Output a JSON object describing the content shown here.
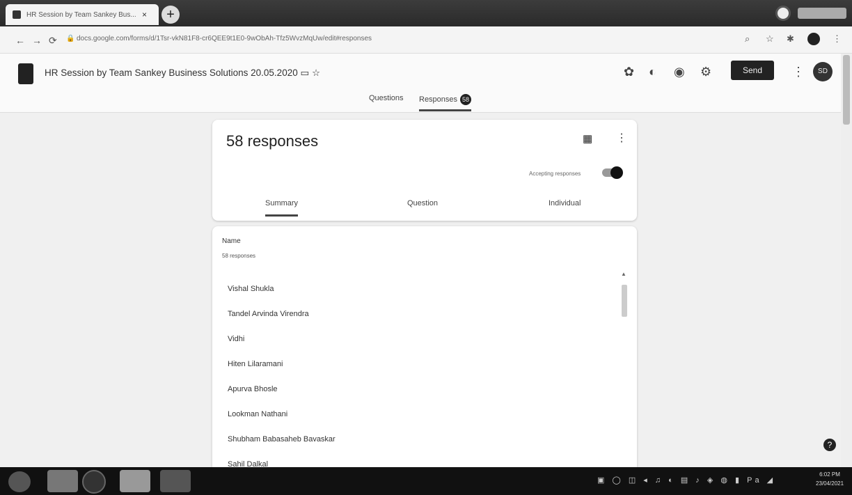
{
  "browser": {
    "tab_title": "HR Session by Team Sankey Bus...",
    "tab_close": "×",
    "new_tab": "+",
    "back": "←",
    "forward": "→",
    "reload": "⟳",
    "lock": "🔒",
    "url": "docs.google.com/forms/d/1Tsr-vkN81F8-cr6QEE9t1E0-9wObAh-Tfz5WvzMqUw/edit#responses"
  },
  "forms_header": {
    "title": "HR Session by Team Sankey Business Solutions 20.05.2020",
    "send_label": "Send",
    "avatar_text": "SD",
    "tabs": [
      {
        "label": "Questions"
      },
      {
        "label": "Responses",
        "badge": "58"
      }
    ]
  },
  "responses_card": {
    "title": "58 responses",
    "accepting_label": "Accepting responses",
    "tabs": [
      {
        "label": "Summary"
      },
      {
        "label": "Question"
      },
      {
        "label": "Individual"
      }
    ]
  },
  "question_card": {
    "title": "Name",
    "count": "58 responses",
    "answers": [
      "Vishal Shukla",
      "Tandel Arvinda Virendra",
      "Vidhi",
      "Hiten Lilaramani",
      "Apurva Bhosle",
      "Lookman Nathani",
      "Shubham Babasaheb Bavaskar",
      "Sahil Dalkal"
    ]
  },
  "taskbar": {
    "tray": "▣ ◯ ◫ ◂ ♫ ◐ ▤ ♪ ◈ ◍ ▮ Pa ◢",
    "time": "6:02 PM",
    "date": "23/04/2021"
  }
}
